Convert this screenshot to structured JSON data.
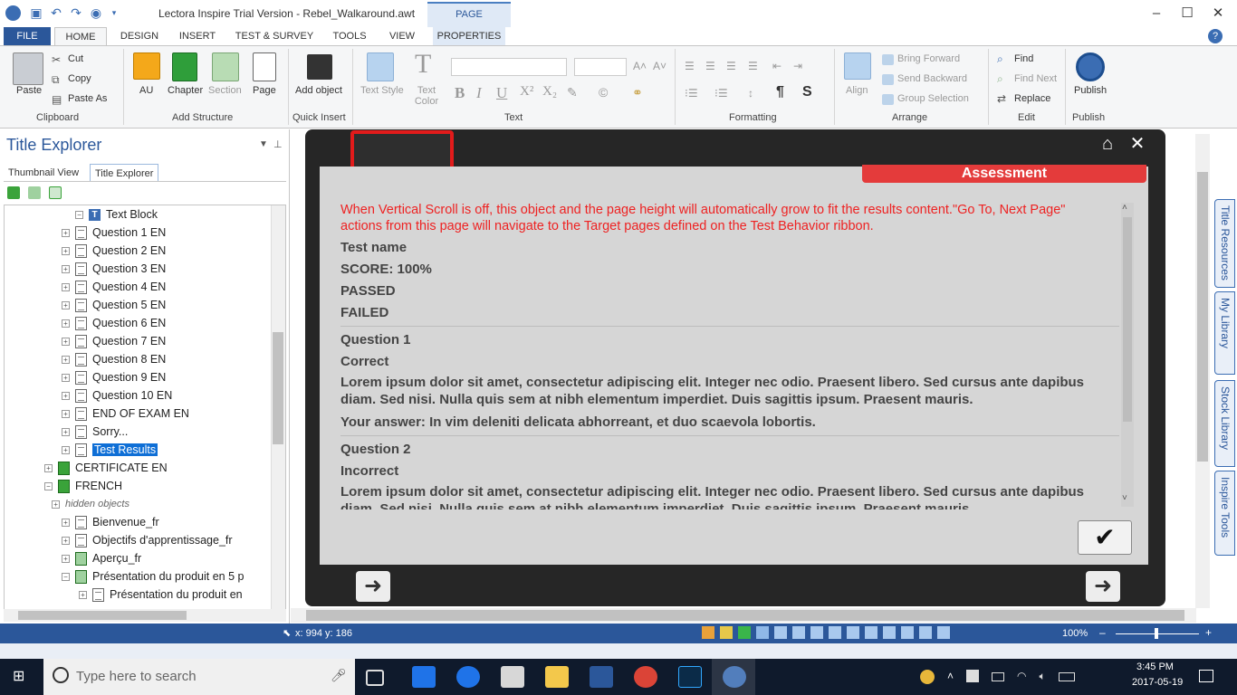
{
  "window": {
    "title": "Lectora Inspire Trial Version - Rebel_Walkaround.awt",
    "context_tab": "PAGE"
  },
  "tabs": [
    "FILE",
    "HOME",
    "DESIGN",
    "INSERT",
    "TEST & SURVEY",
    "TOOLS",
    "VIEW",
    "PROPERTIES"
  ],
  "ribbon": {
    "clipboard": {
      "paste": "Paste",
      "cut": "Cut",
      "copy": "Copy",
      "paste_as": "Paste As",
      "label": "Clipboard"
    },
    "add_structure": {
      "au": "AU",
      "chapter": "Chapter",
      "section": "Section",
      "page": "Page",
      "label": "Add Structure"
    },
    "quick_insert": {
      "add_object": "Add object",
      "label": "Quick Insert"
    },
    "text": {
      "text_style": "Text Style",
      "text_color": "Text Color",
      "label": "Text"
    },
    "formatting": {
      "label": "Formatting"
    },
    "arrange": {
      "align": "Align",
      "bring_forward": "Bring Forward",
      "send_backward": "Send Backward",
      "group_selection": "Group Selection",
      "label": "Arrange"
    },
    "edit": {
      "find": "Find",
      "find_next": "Find Next",
      "replace": "Replace",
      "label": "Edit"
    },
    "publish": {
      "publish": "Publish",
      "label": "Publish"
    }
  },
  "left_panel": {
    "title": "Title Explorer",
    "tabs": [
      "Thumbnail View",
      "Title Explorer"
    ],
    "tree": [
      "Text Block",
      "Question 1 EN",
      "Question 2 EN",
      "Question 3 EN",
      "Question 4 EN",
      "Question 5 EN",
      "Question 6 EN",
      "Question 7 EN",
      "Question 8 EN",
      "Question 9 EN",
      "Question 10 EN",
      "END OF EXAM EN",
      "Sorry...",
      "Test Results",
      "CERTIFICATE EN",
      "FRENCH",
      "hidden objects",
      "Bienvenue_fr",
      "Objectifs d'apprentissage_fr",
      "Aperçu_fr",
      "Présentation du produit en 5 p",
      "Présentation du produit en"
    ]
  },
  "page": {
    "banner": "Assessment",
    "notice": [
      "When Vertical Scroll is off, this object and the page height will automatically grow to fit the results content.\"Go To, Next Page\"",
      "actions from this page will navigate to the Target pages defined on the Test Behavior ribbon."
    ],
    "test_name": "Test name",
    "score": "SCORE: 100%",
    "passed": "PASSED",
    "failed": "FAILED",
    "q1": {
      "title": "Question 1",
      "status": "Correct",
      "line1": "Lorem ipsum dolor sit amet, consectetur adipiscing elit. Integer nec odio. Praesent libero. Sed cursus ante dapibus",
      "line2": "diam. Sed nisi. Nulla quis sem at nibh elementum imperdiet. Duis sagittis ipsum. Praesent mauris.",
      "answer": "Your answer: In vim deleniti delicata abhorreant, et duo scaevola lobortis."
    },
    "q2": {
      "title": "Question 2",
      "status": "Incorrect",
      "line1": "Lorem ipsum dolor sit amet, consectetur adipiscing elit. Integer nec odio. Praesent libero. Sed cursus ante dapibus",
      "line2": "diam. Sed nisi. Nulla quis sem at nibh elementum imperdiet. Duis sagittis ipsum. Praesent mauris."
    }
  },
  "side_tabs": [
    "Title Resources",
    "My Library",
    "Stock Library",
    "Inspire Tools"
  ],
  "status": {
    "coords": "x: 994  y: 186",
    "zoom": "100%"
  },
  "taskbar": {
    "search": "Type here to search",
    "time": "3:45 PM",
    "date": "2017-05-19"
  }
}
